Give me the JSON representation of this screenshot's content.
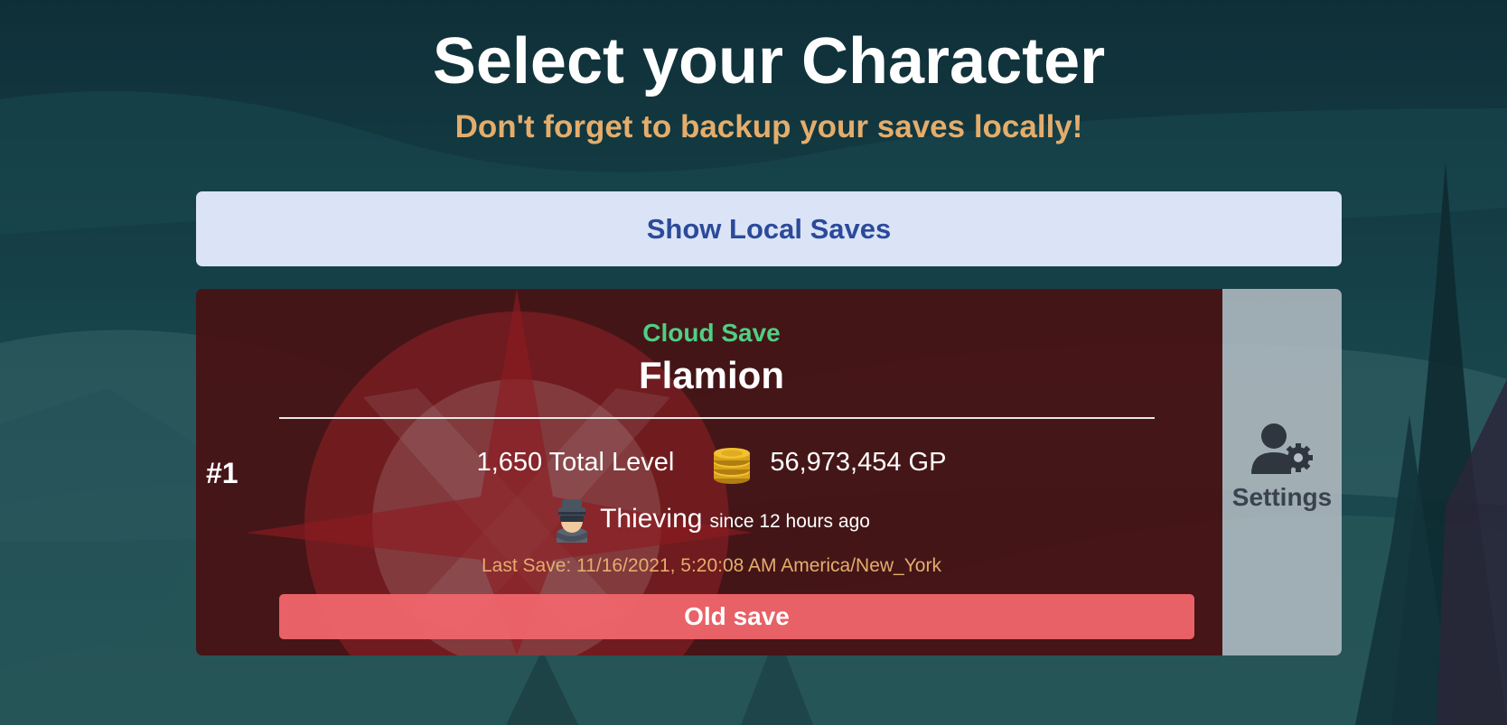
{
  "header": {
    "title": "Select your Character",
    "subtitle": "Don't forget to backup your saves locally!"
  },
  "local_saves_button": {
    "label": "Show Local Saves"
  },
  "save_slot": {
    "number": "#1",
    "save_type": "Cloud Save",
    "character_name": "Flamion",
    "total_level": "1,650 Total Level",
    "gp": "56,973,454 GP",
    "activity_skill": "Thieving",
    "activity_since": "since 12 hours ago",
    "last_save": "Last Save: 11/16/2021, 5:20:08 AM America/New_York",
    "status_button": "Old save",
    "icons": {
      "gp": "coins-icon",
      "activity": "thief-icon",
      "settings": "user-gear-icon"
    }
  },
  "settings_panel": {
    "label": "Settings"
  },
  "colors": {
    "title": "#ffffff",
    "subtitle": "#e4ad6c",
    "local_saves_bg": "#dbe3f6",
    "local_saves_text": "#2b4a9a",
    "card_bg": "#461416",
    "cloud_save": "#4fcf84",
    "last_save_text": "#e4ad6c",
    "old_save_bg": "#ee656a",
    "settings_bg": "#b6bec6",
    "settings_text": "#3a424d"
  }
}
